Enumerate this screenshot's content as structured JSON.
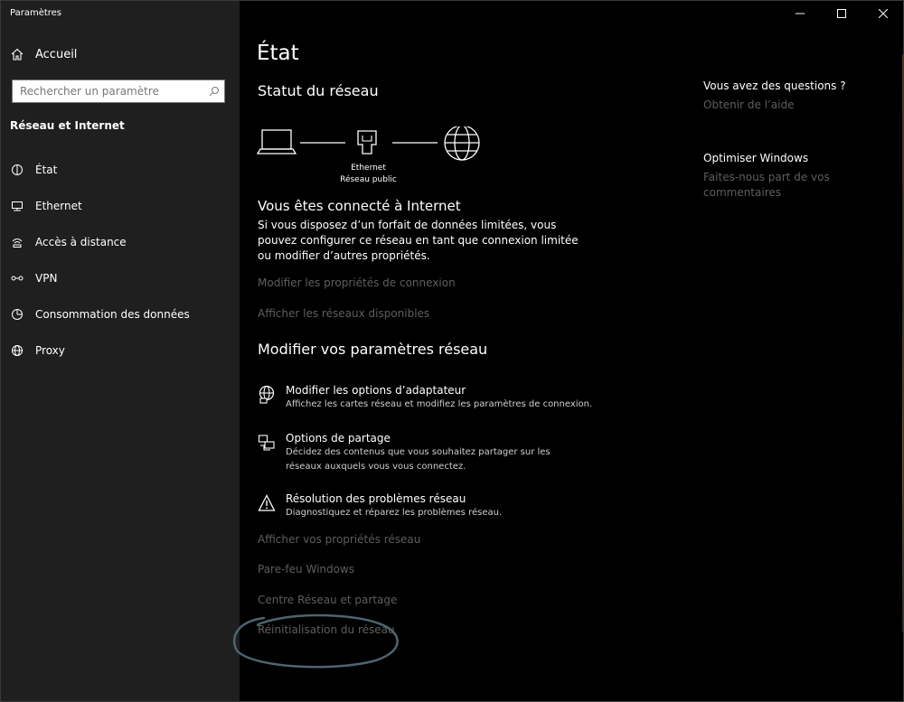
{
  "window": {
    "title": "Paramètres",
    "controls": [
      "minimize",
      "maximize",
      "close"
    ]
  },
  "sidebar": {
    "home_label": "Accueil",
    "search_placeholder": "Rechercher un paramètre",
    "section_title": "Réseau et Internet",
    "items": [
      {
        "label": "État",
        "icon": "status-icon"
      },
      {
        "label": "Ethernet",
        "icon": "ethernet-icon"
      },
      {
        "label": "Accès à distance",
        "icon": "dialup-icon"
      },
      {
        "label": "VPN",
        "icon": "vpn-icon"
      },
      {
        "label": "Consommation des données",
        "icon": "data-usage-icon"
      },
      {
        "label": "Proxy",
        "icon": "globe-icon"
      }
    ]
  },
  "main": {
    "page_title": "État",
    "status_title": "Statut du réseau",
    "diagram": {
      "line1": "Ethernet",
      "line2": "Réseau public"
    },
    "connected_title": "Vous êtes connecté à Internet",
    "connected_desc": "Si vous disposez d’un forfait de données limitées, vous pouvez configurer ce réseau en tant que connexion limitée ou modifier d’autres propriétés.",
    "link_conn_props": "Modifier les propriétés de connexion",
    "link_show_networks": "Afficher les réseaux disponibles",
    "modify_title": "Modifier vos paramètres réseau",
    "options": [
      {
        "title": "Modifier les options d’adaptateur",
        "desc": "Affichez les cartes réseau et modifiez les paramètres de connexion.",
        "icon": "adapter-icon"
      },
      {
        "title": "Options de partage",
        "desc": "Décidez des contenus que vous souhaitez partager sur les réseaux auxquels vous vous connectez.",
        "icon": "sharing-icon"
      },
      {
        "title": "Résolution des problèmes réseau",
        "desc": "Diagnostiquez et réparez les problèmes réseau.",
        "icon": "warning-icon"
      }
    ],
    "bottom_links": [
      "Afficher vos propriétés réseau",
      "Pare-feu Windows",
      "Centre Réseau et partage",
      "Réinitialisation du réseau"
    ]
  },
  "right": {
    "questions_title": "Vous avez des questions ?",
    "help_link": "Obtenir de l’aide",
    "improve_title": "Optimiser Windows",
    "feedback_link": "Faites-nous part de vos commentaires"
  }
}
